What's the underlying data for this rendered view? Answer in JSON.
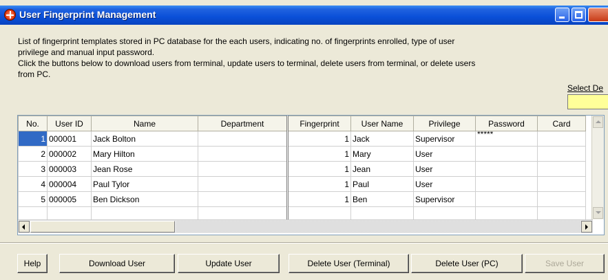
{
  "window": {
    "title": "User Fingerprint Management"
  },
  "description": {
    "line1": "List of fingerprint templates stored in PC database for the each users, indicating no. of fingerprints enrolled, type of user",
    "line2": "privilege and manual input password.",
    "line3": "Click the buttons below to download users from terminal, update users to terminal, delete users from terminal, or delete users",
    "line4": "from PC."
  },
  "select_device": {
    "label": "Select De",
    "value": ""
  },
  "table": {
    "columns": [
      "No.",
      "User ID",
      "Name",
      "Department",
      "Fingerprint",
      "User Name",
      "Privilege",
      "Password",
      "Card"
    ],
    "rows": [
      {
        "no": "1",
        "user_id": "000001",
        "name": "Jack Bolton",
        "department": "",
        "fingerprint": "1",
        "user_name": "Jack",
        "privilege": "Supervisor",
        "password": "*****",
        "card": ""
      },
      {
        "no": "2",
        "user_id": "000002",
        "name": "Mary Hilton",
        "department": "",
        "fingerprint": "1",
        "user_name": "Mary",
        "privilege": "User",
        "password": "",
        "card": ""
      },
      {
        "no": "3",
        "user_id": "000003",
        "name": "Jean Rose",
        "department": "",
        "fingerprint": "1",
        "user_name": "Jean",
        "privilege": "User",
        "password": "",
        "card": ""
      },
      {
        "no": "4",
        "user_id": "000004",
        "name": "Paul Tylor",
        "department": "",
        "fingerprint": "1",
        "user_name": "Paul",
        "privilege": "User",
        "password": "",
        "card": ""
      },
      {
        "no": "5",
        "user_id": "000005",
        "name": "Ben Dickson",
        "department": "",
        "fingerprint": "1",
        "user_name": "Ben",
        "privilege": "Supervisor",
        "password": "",
        "card": ""
      }
    ]
  },
  "buttons": {
    "help": "Help",
    "download_user": "Download User",
    "update_user": "Update User",
    "delete_user_terminal": "Delete User (Terminal)",
    "delete_user_pc": "Delete User (PC)",
    "save_user": "Save User"
  }
}
